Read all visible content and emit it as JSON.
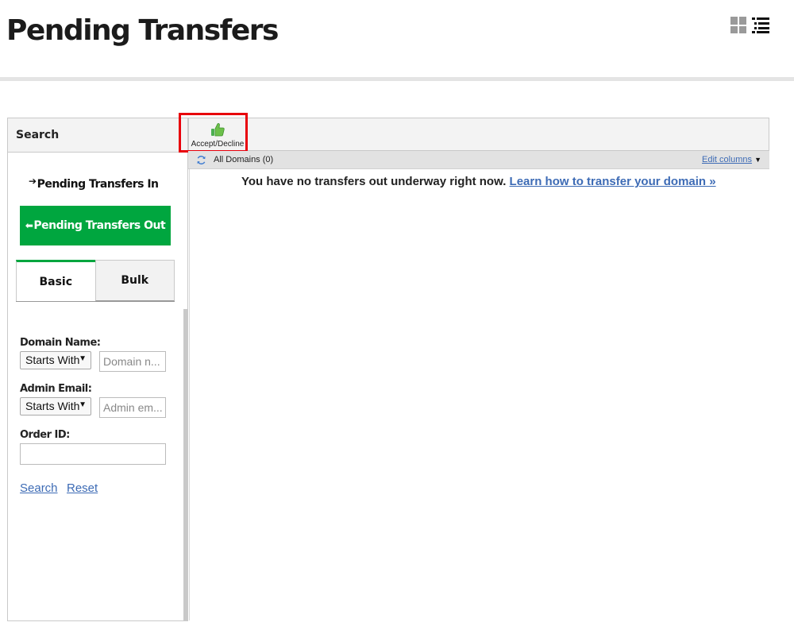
{
  "page": {
    "title": "Pending Transfers"
  },
  "view_toggle": {
    "grid_icon": "grid-view-icon",
    "list_icon": "list-view-icon"
  },
  "search_panel": {
    "header": "Search",
    "nav_in": {
      "arrow": "➔",
      "label": "Pending Transfers In"
    },
    "nav_out": {
      "arrow": "⬅",
      "label": "Pending Transfers Out"
    },
    "tabs": [
      {
        "label": "Basic"
      },
      {
        "label": "Bulk"
      }
    ],
    "domain_name": {
      "label": "Domain Name:",
      "select_value": "Starts With",
      "placeholder": "Domain n..."
    },
    "admin_email": {
      "label": "Admin Email:",
      "select_value": "Starts With",
      "placeholder": "Admin em..."
    },
    "order_id": {
      "label": "Order ID:",
      "value": ""
    },
    "search_link": "Search",
    "reset_link": "Reset"
  },
  "toolbar": {
    "accept_decline_label": "Accept/Decline",
    "icon": "thumbs-up-icon"
  },
  "domains_bar": {
    "label": "All Domains (0)",
    "edit_columns": "Edit columns"
  },
  "message": {
    "text": "You have no transfers out underway right now.",
    "link": "Learn how to transfer your domain »"
  },
  "colors": {
    "accent_green": "#00a63f",
    "link_blue": "#3d6bb5",
    "highlight_red": "#e8000b"
  }
}
